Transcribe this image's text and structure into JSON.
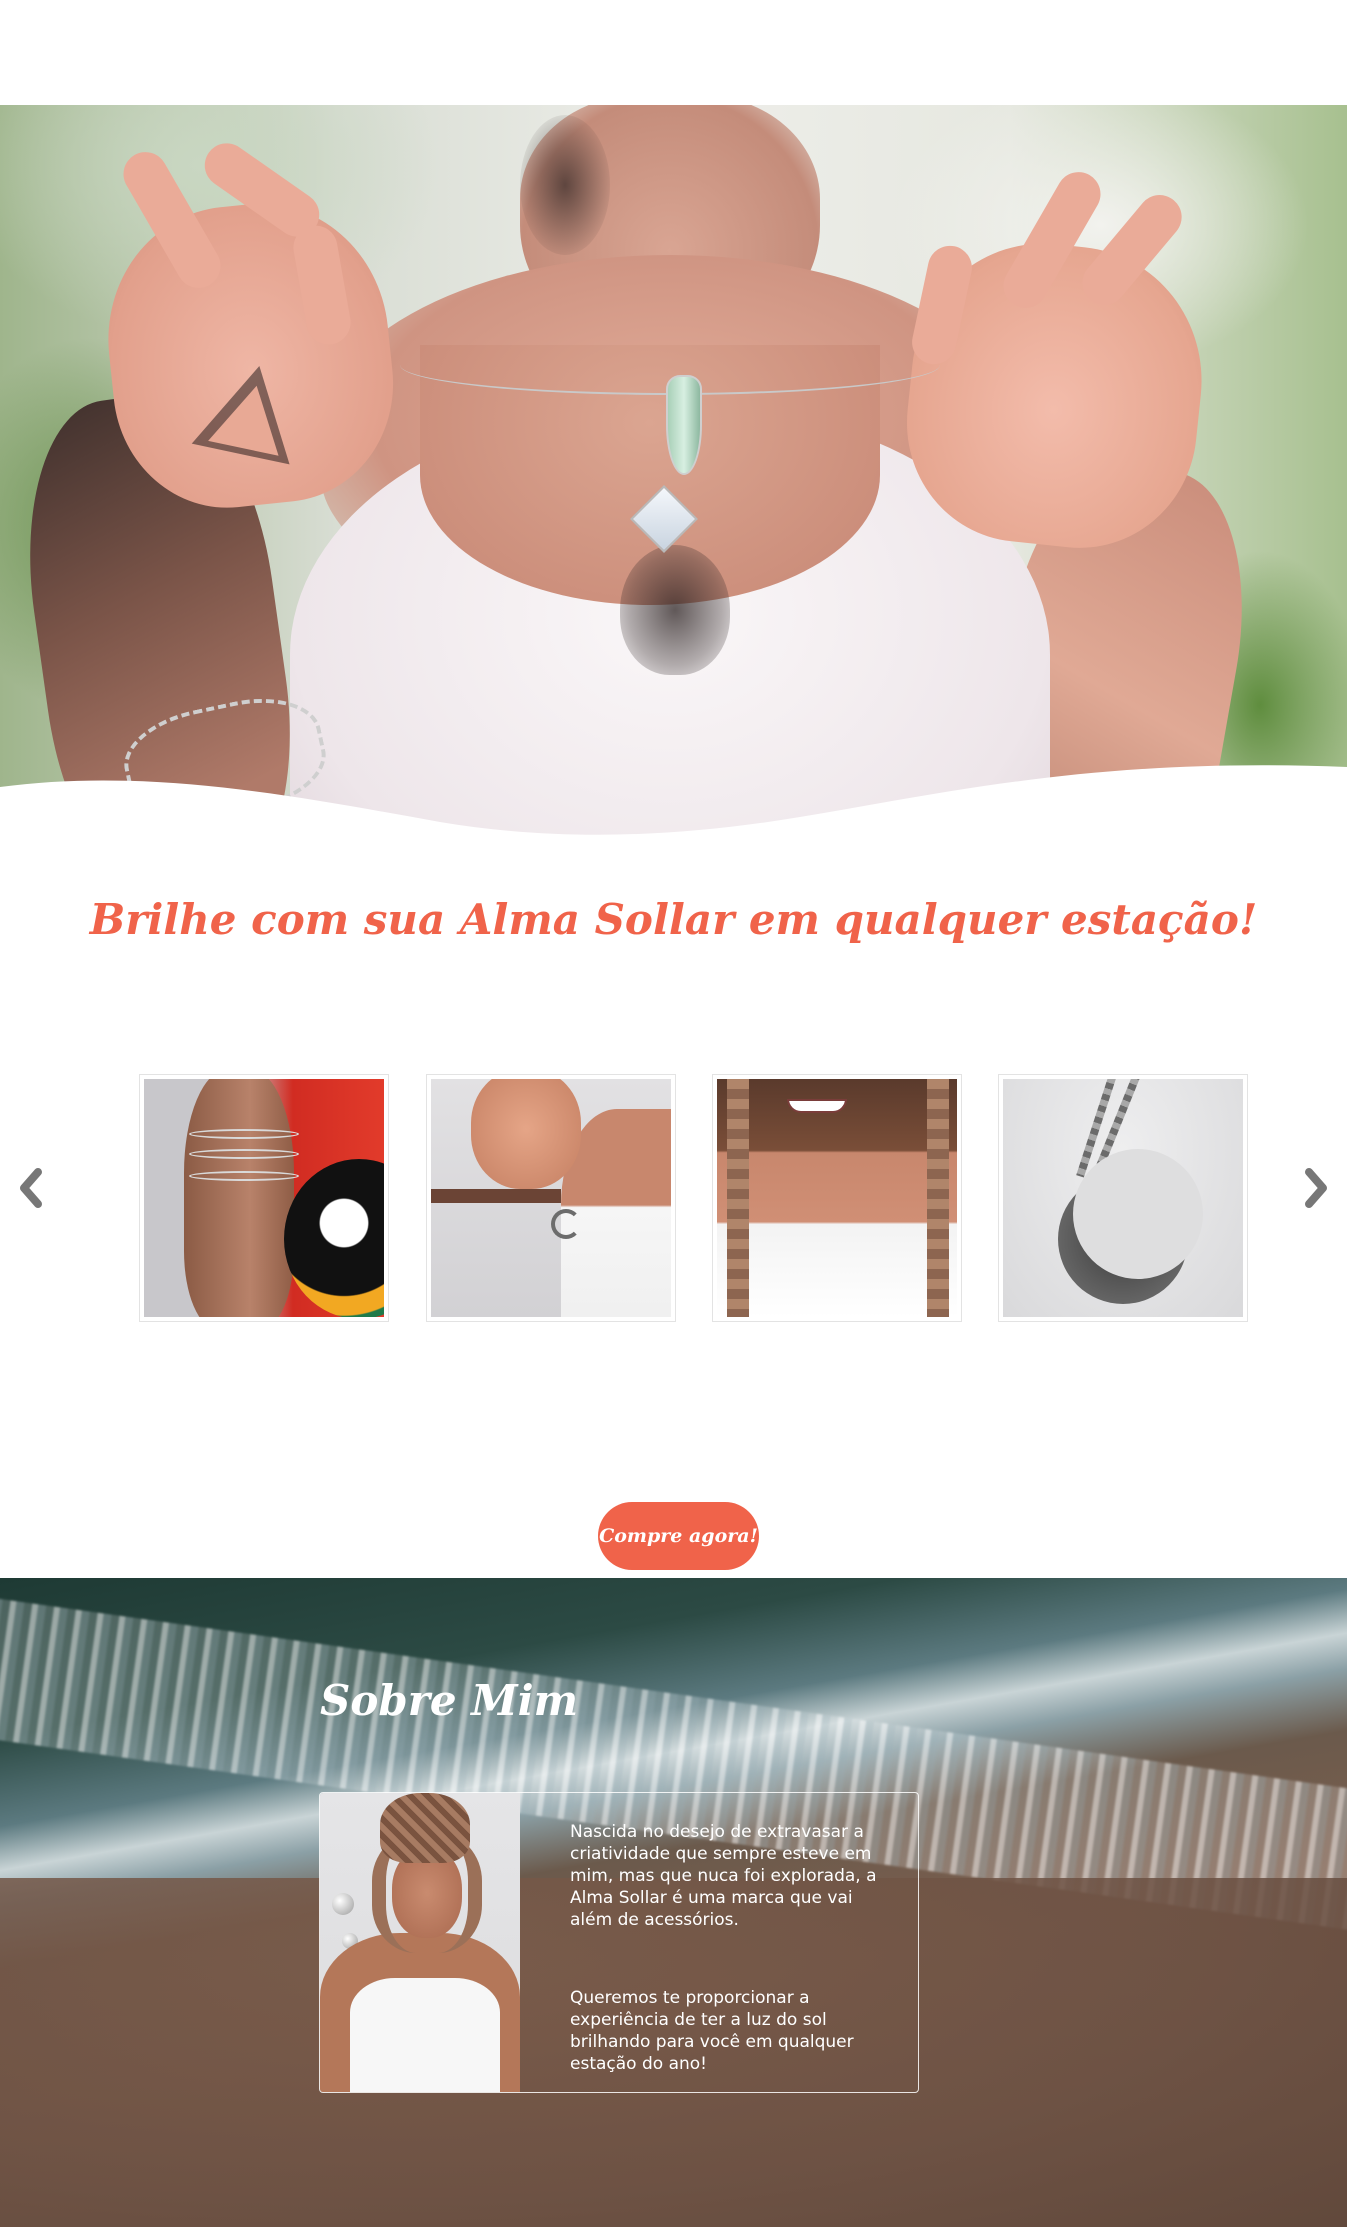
{
  "hero": {
    "image_alt": "Woman holding a crystal necklace"
  },
  "headline": "Brilhe com sua Alma Sollar em qualquer estação!",
  "carousel": {
    "prev_icon": "chevron-left-icon",
    "next_icon": "chevron-right-icon",
    "icon_color": "#777777",
    "items": [
      {
        "alt": "Pulseiras no pulso"
      },
      {
        "alt": "Colar de lua na mão"
      },
      {
        "alt": "Colares em modelo sorrindo"
      },
      {
        "alt": "Colar com pingente de lua"
      }
    ]
  },
  "cta": {
    "label": "Compre agora!"
  },
  "about": {
    "title": "Sobre Mim",
    "paragraph_1": "Nascida no desejo de extravasar a criatividade que sempre esteve em mim, mas que nuca foi explorada, a Alma Sollar é uma marca que vai além de acessórios.",
    "paragraph_2": "Queremos te proporcionar a experiência de ter a luz do sol brilhando para você em qualquer estação do ano!"
  },
  "colors": {
    "accent": "#f0634a",
    "white": "#ffffff"
  }
}
